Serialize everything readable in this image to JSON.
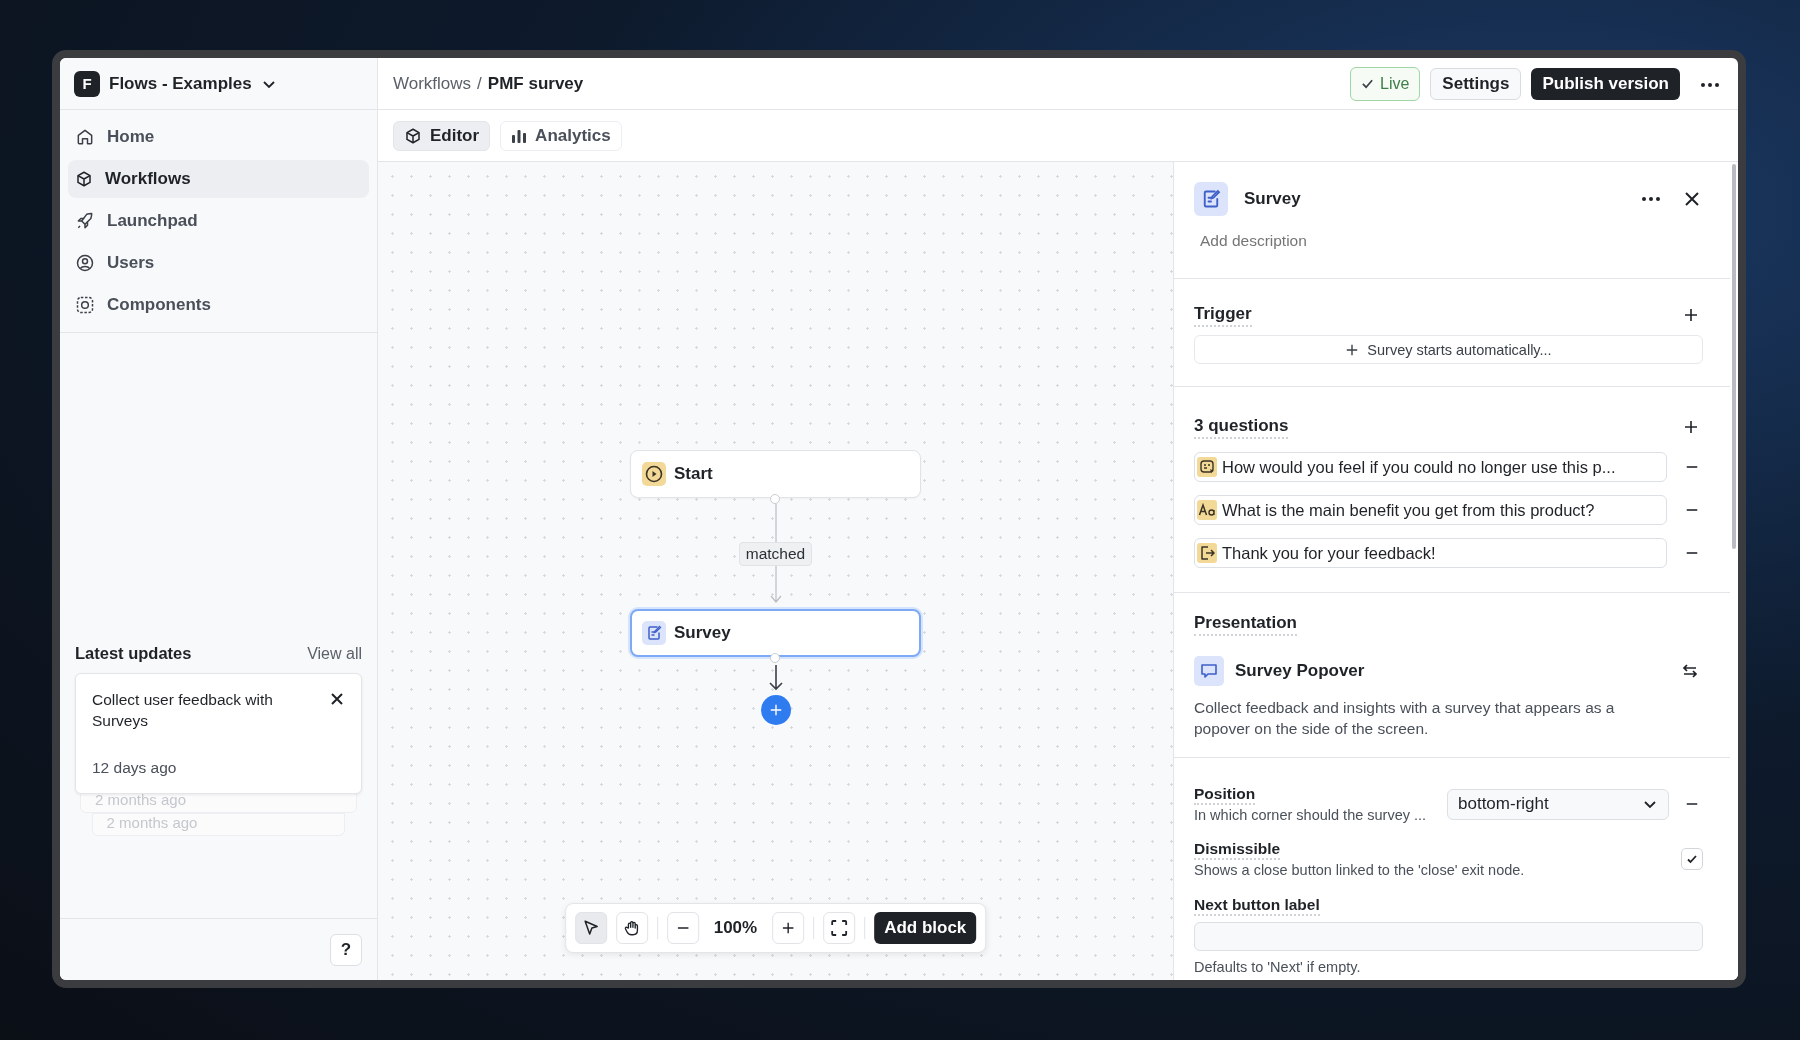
{
  "workspace": {
    "initial": "F",
    "name": "Flows - Examples"
  },
  "sidebar": {
    "items": [
      {
        "label": "Home",
        "kind": "home",
        "selected": false
      },
      {
        "label": "Workflows",
        "kind": "cube",
        "selected": true
      },
      {
        "label": "Launchpad",
        "kind": "rocket",
        "selected": false
      },
      {
        "label": "Users",
        "kind": "user",
        "selected": false
      },
      {
        "label": "Components",
        "kind": "components",
        "selected": false
      }
    ]
  },
  "latest_updates": {
    "title": "Latest updates",
    "view_all": "View all",
    "card": {
      "title": "Collect user feedback with Surveys",
      "time": "12 days ago"
    },
    "older": [
      "2 months ago",
      "2 months ago"
    ]
  },
  "help": "?",
  "breadcrumbs": {
    "parent": "Workflows",
    "separator": "/",
    "current": "PMF survey"
  },
  "header_actions": {
    "status": "Live",
    "settings": "Settings",
    "publish": "Publish version"
  },
  "tabs": [
    {
      "label": "Editor",
      "kind": "cube",
      "selected": true
    },
    {
      "label": "Analytics",
      "kind": "chart",
      "selected": false
    }
  ],
  "canvas": {
    "nodes": [
      {
        "label": "Start",
        "kind": "start",
        "selected": false
      },
      {
        "label": "Survey",
        "kind": "survey",
        "selected": true
      }
    ],
    "edge_label": "matched",
    "toolbar": {
      "tools": [
        {
          "kind": "pointer",
          "selected": true
        },
        {
          "kind": "hand",
          "selected": false
        }
      ],
      "zoom": "100%",
      "add": "Add block"
    }
  },
  "panel": {
    "title": "Survey",
    "description_placeholder": "Add description",
    "trigger": {
      "title": "Trigger",
      "button": "Survey starts automatically..."
    },
    "questions": {
      "title": "3 questions",
      "items": [
        {
          "text": "How would you feel if you could no longer use this p...",
          "kind": "rating"
        },
        {
          "text": "What is the main benefit you get from this product?",
          "kind": "text"
        },
        {
          "text": "Thank you for your feedback!",
          "kind": "exit"
        }
      ]
    },
    "presentation": {
      "title": "Presentation",
      "name": "Survey Popover",
      "description": "Collect feedback and insights with a survey that appears as a popover on the side of the screen."
    },
    "position": {
      "label": "Position",
      "hint": "In which corner should the survey ...",
      "value": "bottom-right"
    },
    "dismissible": {
      "label": "Dismissible",
      "hint": "Shows a close button linked to the 'close' exit node.",
      "checked": true
    },
    "next_button": {
      "label": "Next button label",
      "hint": "Defaults to 'Next' if empty."
    }
  }
}
